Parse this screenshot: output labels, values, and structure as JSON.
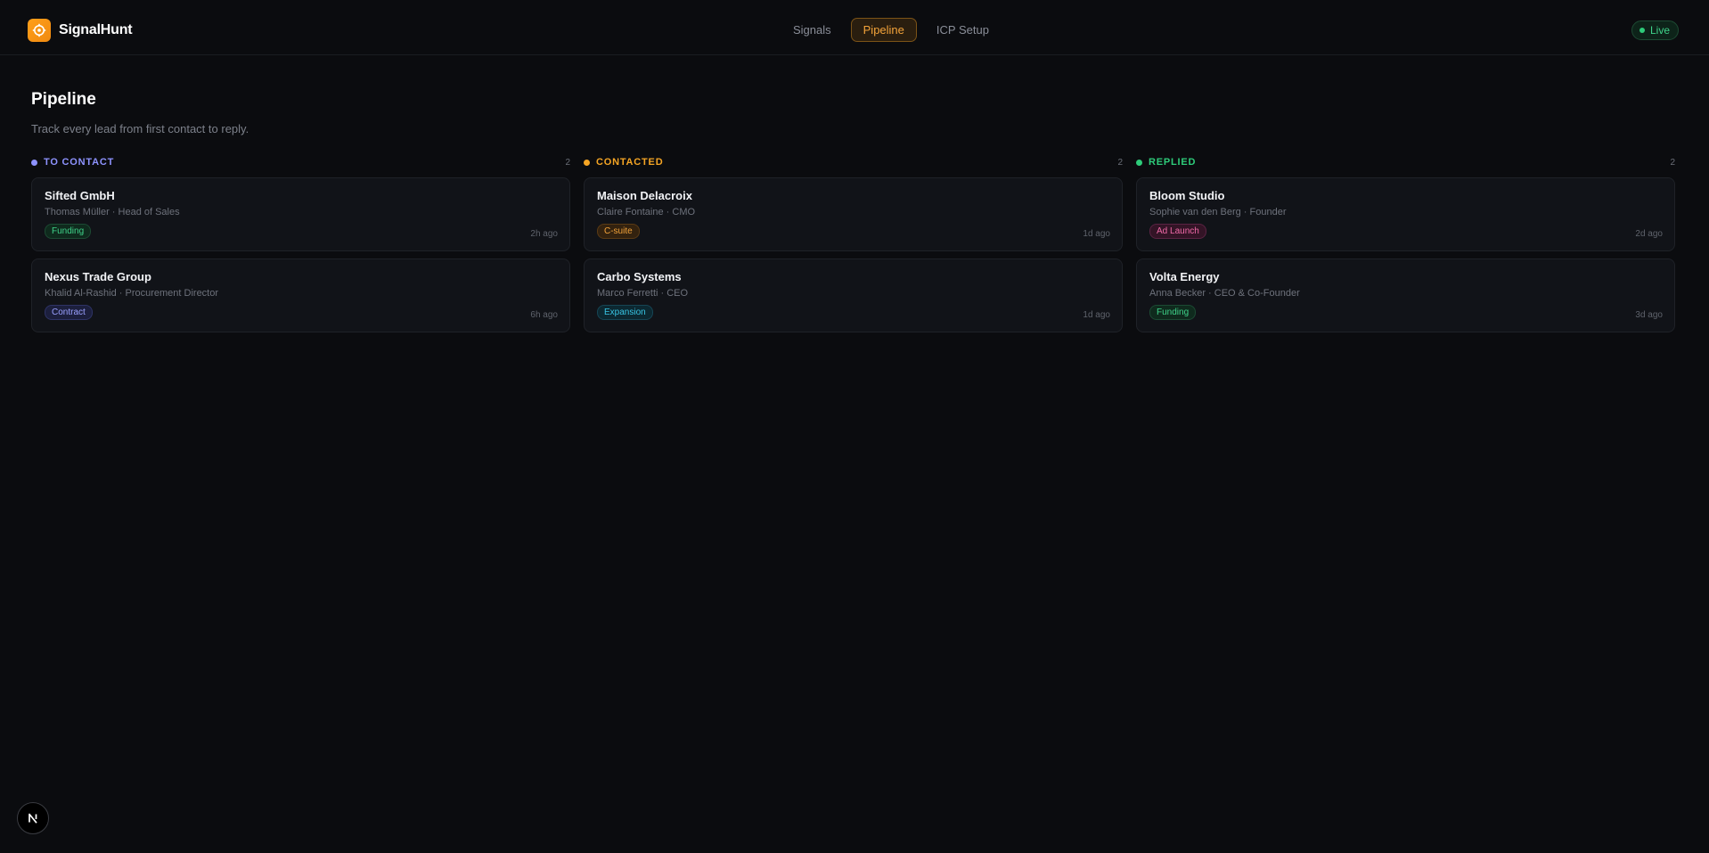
{
  "app": {
    "name": "SignalHunt"
  },
  "nav": {
    "tabs": [
      {
        "label": "Signals",
        "active": false
      },
      {
        "label": "Pipeline",
        "active": true
      },
      {
        "label": "ICP Setup",
        "active": false
      }
    ]
  },
  "status": {
    "label": "Live"
  },
  "page": {
    "title": "Pipeline",
    "subtitle": "Track every lead from first contact to reply."
  },
  "colors": {
    "accent": "#f3a33a",
    "to_contact": "#8e93ff",
    "contacted": "#f5a524",
    "replied": "#2ecc7a"
  },
  "columns": [
    {
      "title": "TO CONTACT",
      "count": "2",
      "color": "#8e93ff",
      "cards": [
        {
          "company": "Sifted GmbH",
          "person": "Thomas Müller · Head of Sales",
          "tag": "Funding",
          "tag_color": "#3fd38a",
          "tag_bg": "#0f2a1d",
          "time": "2h ago"
        },
        {
          "company": "Nexus Trade Group",
          "person": "Khalid Al-Rashid · Procurement Director",
          "tag": "Contract",
          "tag_color": "#9aa0ff",
          "tag_bg": "#1c1f3d",
          "time": "6h ago"
        }
      ]
    },
    {
      "title": "CONTACTED",
      "count": "2",
      "color": "#f5a524",
      "cards": [
        {
          "company": "Maison Delacroix",
          "person": "Claire Fontaine · CMO",
          "tag": "C-suite",
          "tag_color": "#f3a33a",
          "tag_bg": "#33220f",
          "time": "1d ago"
        },
        {
          "company": "Carbo Systems",
          "person": "Marco Ferretti · CEO",
          "tag": "Expansion",
          "tag_color": "#38c4e3",
          "tag_bg": "#0c2831",
          "time": "1d ago"
        }
      ]
    },
    {
      "title": "REPLIED",
      "count": "2",
      "color": "#2ecc7a",
      "cards": [
        {
          "company": "Bloom Studio",
          "person": "Sophie van den Berg · Founder",
          "tag": "Ad Launch",
          "tag_color": "#f06aa8",
          "tag_bg": "#331426",
          "time": "2d ago"
        },
        {
          "company": "Volta Energy",
          "person": "Anna Becker · CEO & Co-Founder",
          "tag": "Funding",
          "tag_color": "#3fd38a",
          "tag_bg": "#0f2a1d",
          "time": "3d ago"
        }
      ]
    }
  ],
  "dev_badge": {
    "icon": "nextjs-logo-icon"
  }
}
